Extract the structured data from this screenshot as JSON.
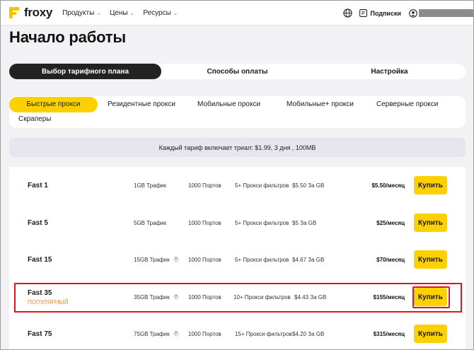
{
  "header": {
    "logo_text": "froxy",
    "nav": [
      {
        "label": "Продукты"
      },
      {
        "label": "Цены"
      },
      {
        "label": "Ресурсы"
      }
    ],
    "subscriptions_label": "Подписки",
    "user_name_redacted": true
  },
  "page_title": "Начало работы",
  "main_tabs": [
    {
      "label": "Выбор тарифного плана",
      "active": true
    },
    {
      "label": "Способы оплаты",
      "active": false
    },
    {
      "label": "Настройка",
      "active": false
    }
  ],
  "proxy_tabs": [
    {
      "label": "Быстрые прокси",
      "active": true
    },
    {
      "label": "Резидентные прокси",
      "active": false
    },
    {
      "label": "Мобильные прокси",
      "active": false
    },
    {
      "label": "Мобильные+ прокси",
      "active": false
    },
    {
      "label": "Серверные прокси",
      "active": false
    },
    {
      "label": "Скраперы",
      "active": false
    }
  ],
  "trial_text": "Каждый тариф включает триал: $1.99, 3 дня , 100MB",
  "plans": [
    {
      "name": "Fast 1",
      "badge": "",
      "traffic": "1GB Трафик",
      "traffic_help": false,
      "ports": "1000 Портов",
      "filters": "5+ Прокси фильтров",
      "per_gb": "$5.50 За GB",
      "price": "$5.50/месяц",
      "buy_label": "Купить"
    },
    {
      "name": "Fast 5",
      "badge": "",
      "traffic": "5GB Трафик",
      "traffic_help": false,
      "ports": "1000 Портов",
      "filters": "5+ Прокси фильтров",
      "per_gb": "$5 За GB",
      "price": "$25/месяц",
      "buy_label": "Купить"
    },
    {
      "name": "Fast 15",
      "badge": "",
      "traffic": "15GB Трафик",
      "traffic_help": true,
      "ports": "1000 Портов",
      "filters": "5+ Прокси фильтров",
      "per_gb": "$4.67 За GB",
      "price": "$70/месяц",
      "buy_label": "Купить"
    },
    {
      "name": "Fast 35",
      "badge": "ПОПУЛЯРНЫЙ",
      "traffic": "35GB Трафик",
      "traffic_help": true,
      "ports": "1000 Портов",
      "filters": "10+ Прокси фильтров",
      "per_gb": "$4.43 За GB",
      "price": "$155/месяц",
      "buy_label": "Купить"
    },
    {
      "name": "Fast 75",
      "badge": "",
      "traffic": "75GB Трафик",
      "traffic_help": true,
      "ports": "1000 Портов",
      "filters": "15+ Прокси фильтров",
      "per_gb": "$4.20 За GB",
      "price": "$315/месяц",
      "buy_label": "Купить"
    }
  ],
  "help_glyph": "?",
  "colors": {
    "accent": "#fdd000",
    "highlight": "#e0141b",
    "badge": "#f08a1c"
  }
}
